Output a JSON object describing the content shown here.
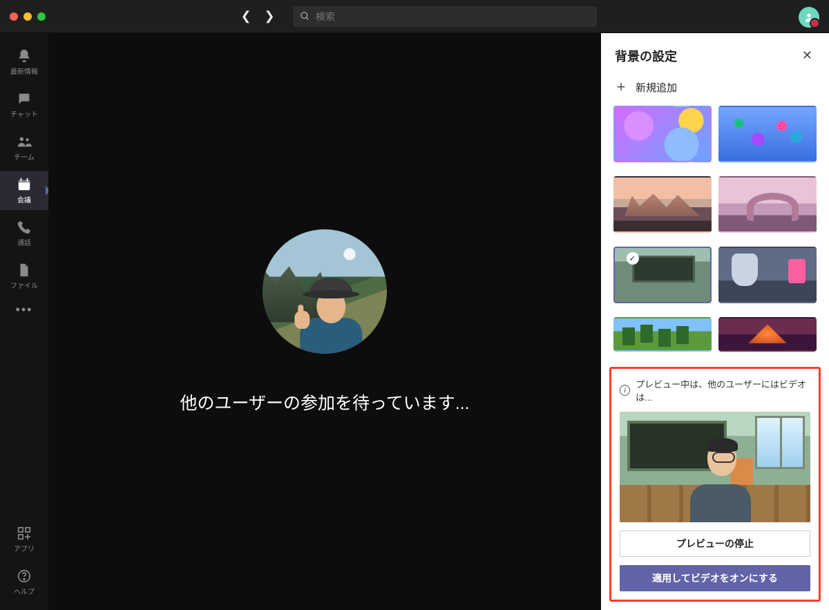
{
  "search": {
    "placeholder": "検索"
  },
  "siderail": {
    "items": [
      {
        "label": "最新情報"
      },
      {
        "label": "チャット"
      },
      {
        "label": "チーム"
      },
      {
        "label": "会議"
      },
      {
        "label": "通話"
      },
      {
        "label": "ファイル"
      }
    ],
    "apps_label": "アプリ",
    "help_label": "ヘルプ"
  },
  "stage": {
    "waiting_text": "他のユーザーの参加を待っています..."
  },
  "panel": {
    "title": "背景の設定",
    "add_new": "新規追加",
    "preview_info": "プレビュー中は、他のユーザーにはビデオは...",
    "stop_preview": "プレビューの停止",
    "apply_turn_on": "適用してビデオをオンにする",
    "selected_index": 4,
    "backgrounds": [
      "balloons-pastel",
      "spheres-blue",
      "bridge-sunset",
      "rock-arch",
      "classroom",
      "space-station",
      "minecraft-forest",
      "minecraft-nether"
    ]
  }
}
